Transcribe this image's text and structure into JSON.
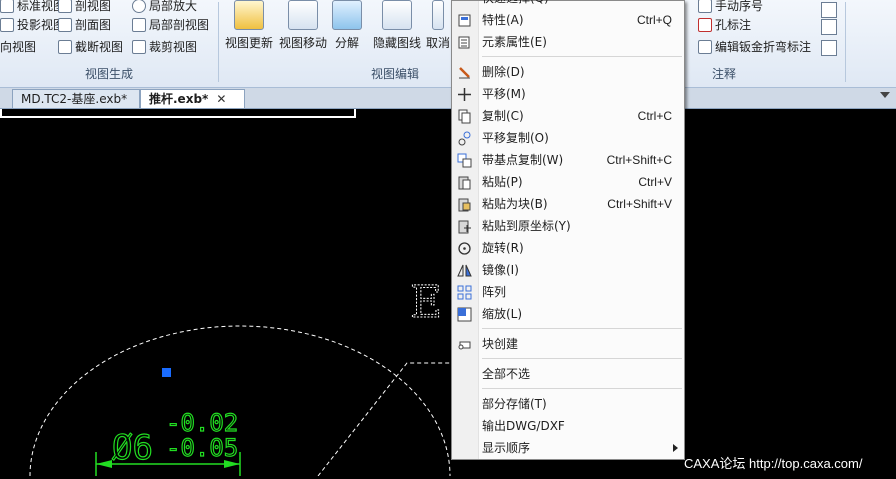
{
  "ribbon": {
    "view_gen": {
      "title": "视图生成",
      "items": [
        "标准视图",
        "剖视图",
        "局部放大",
        "投影视图",
        "剖面图",
        "局部剖视图",
        "向视图",
        "截断视图",
        "裁剪视图"
      ]
    },
    "view_edit": {
      "title": "视图编辑",
      "buttons": [
        "视图更新",
        "视图移动",
        "分解",
        "隐藏图线",
        "取消"
      ]
    },
    "annotate": {
      "title": "注释",
      "items": [
        "手动序号",
        "孔标注",
        "编辑钣金折弯标注"
      ]
    }
  },
  "tabs": [
    {
      "label": "MD.TC2-基座.exb*",
      "active": false
    },
    {
      "label": "推杆.exb*",
      "active": true
    }
  ],
  "menu": {
    "top_partial_label": "快速选择(Q)",
    "items": [
      {
        "label": "特性(A)",
        "shortcut": "Ctrl+Q",
        "icon": "properties-icon"
      },
      {
        "label": "元素属性(E)",
        "shortcut": "",
        "icon": "element-attributes-icon"
      },
      {
        "label": "删除(D)",
        "shortcut": "",
        "icon": "eraser-icon"
      },
      {
        "label": "平移(M)",
        "shortcut": "",
        "icon": "move-icon"
      },
      {
        "label": "复制(C)",
        "shortcut": "Ctrl+C",
        "icon": "copy-icon"
      },
      {
        "label": "平移复制(O)",
        "shortcut": "",
        "icon": "move-copy-icon"
      },
      {
        "label": "带基点复制(W)",
        "shortcut": "Ctrl+Shift+C",
        "icon": "copy-with-base-icon"
      },
      {
        "label": "粘贴(P)",
        "shortcut": "Ctrl+V",
        "icon": "paste-icon"
      },
      {
        "label": "粘贴为块(B)",
        "shortcut": "Ctrl+Shift+V",
        "icon": "paste-as-block-icon"
      },
      {
        "label": "粘贴到原坐标(Y)",
        "shortcut": "",
        "icon": "paste-original-coords-icon"
      },
      {
        "label": "旋转(R)",
        "shortcut": "",
        "icon": "rotate-icon"
      },
      {
        "label": "镜像(I)",
        "shortcut": "",
        "icon": "mirror-icon"
      },
      {
        "label": "阵列",
        "shortcut": "",
        "icon": "array-icon"
      },
      {
        "label": "缩放(L)",
        "shortcut": "",
        "icon": "scale-icon"
      },
      {
        "label": "块创建",
        "shortcut": "",
        "icon": "block-create-icon"
      },
      {
        "label": "全部不选",
        "shortcut": "",
        "icon": ""
      },
      {
        "label": "部分存储(T)",
        "shortcut": "",
        "icon": ""
      },
      {
        "label": "输出DWG/DXF",
        "shortcut": "",
        "icon": ""
      },
      {
        "label": "显示顺序",
        "shortcut": "",
        "icon": ""
      }
    ]
  },
  "drawing": {
    "letter": "E",
    "dimension_main": "Ø6",
    "tolerance_upper": "-0.02",
    "tolerance_lower": "-0.05",
    "colors": {
      "dimension": "#22dd22",
      "dashed": "#ffffff",
      "grip": "#1a6cff"
    }
  },
  "watermark": "CAXA论坛 http://top.caxa.com/"
}
